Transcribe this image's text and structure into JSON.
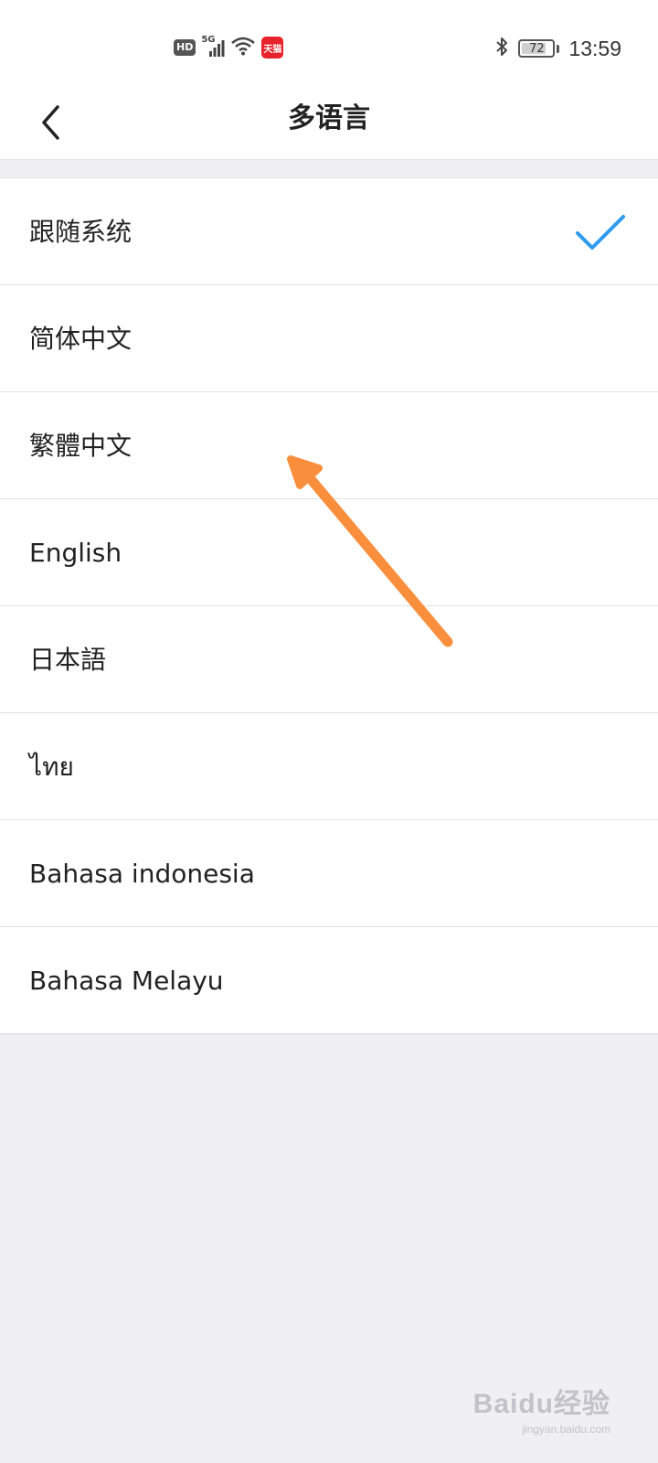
{
  "status_bar": {
    "hd_badge": "HD",
    "network_label": "5G",
    "app_badge": "天猫",
    "battery_level": "72",
    "time": "13:59"
  },
  "header": {
    "title": "多语言",
    "back_icon": "chevron-left-icon"
  },
  "languages": [
    {
      "label": "跟随系统",
      "selected": true
    },
    {
      "label": "简体中文",
      "selected": false
    },
    {
      "label": "繁體中文",
      "selected": false
    },
    {
      "label": "English",
      "selected": false
    },
    {
      "label": "日本語",
      "selected": false
    },
    {
      "label": "ไทย",
      "selected": false
    },
    {
      "label": "Bahasa indonesia",
      "selected": false
    },
    {
      "label": "Bahasa Melayu",
      "selected": false
    }
  ],
  "watermark": {
    "main": "Baidu经验",
    "sub": "jingyan.baidu.com"
  },
  "colors": {
    "accent_check": "#2f9bf0",
    "annotation_arrow": "#f98f3d",
    "list_background": "#ffffff",
    "page_background": "#efeff4"
  }
}
